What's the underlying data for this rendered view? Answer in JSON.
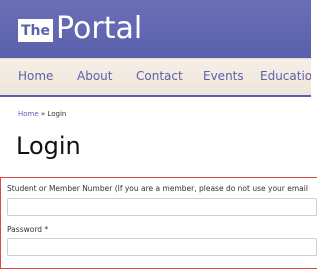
{
  "header": {
    "logo_the": "The",
    "logo_portal": "Portal"
  },
  "nav": {
    "items": [
      {
        "label": "Home"
      },
      {
        "label": "About"
      },
      {
        "label": "Contact"
      },
      {
        "label": "Events"
      },
      {
        "label": "Educatio"
      }
    ]
  },
  "breadcrumb": {
    "home": "Home",
    "separator": "»",
    "current": "Login"
  },
  "page": {
    "title": "Login"
  },
  "form": {
    "student_label": "Student or Member Number (If you are a member, please do not use your email",
    "student_value": "",
    "password_label": "Password *",
    "password_value": ""
  },
  "colors": {
    "brand_purple": "#5b61ad",
    "nav_bg": "#efe6da",
    "form_border": "#d64a4a"
  }
}
